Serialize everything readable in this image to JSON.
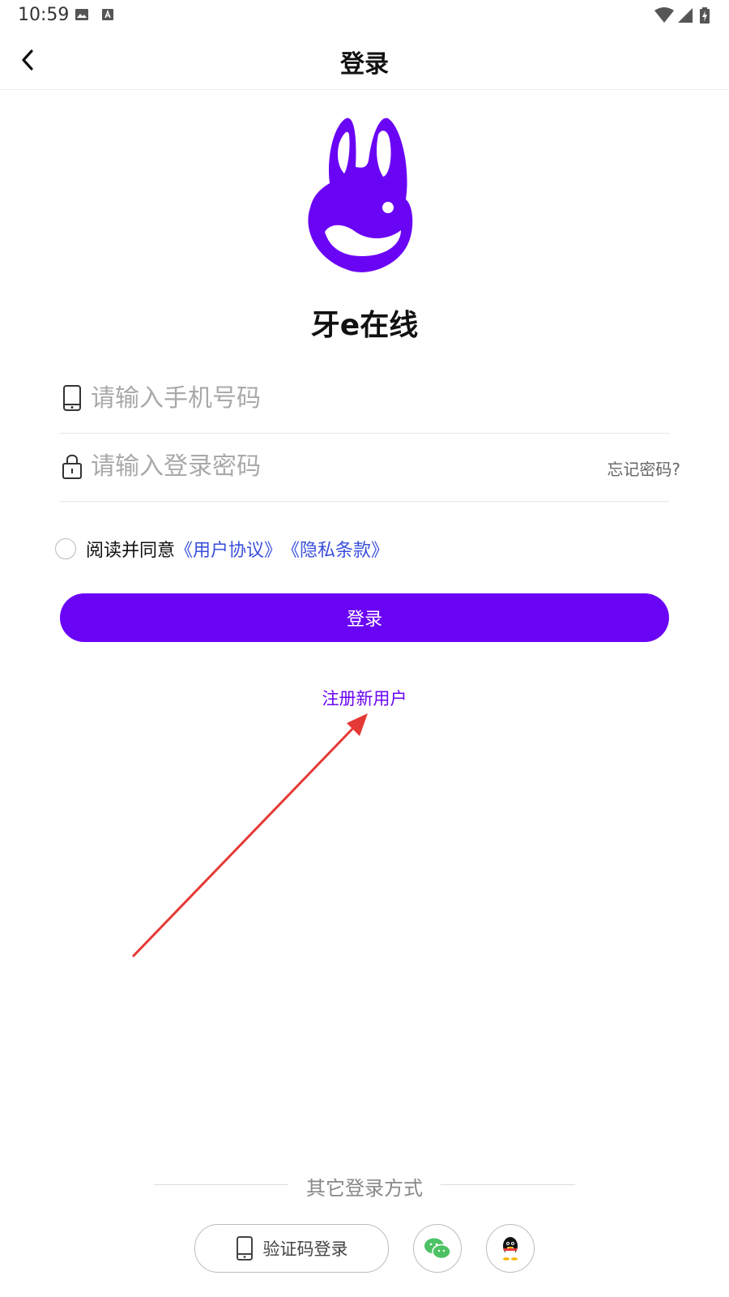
{
  "status_bar": {
    "time": "10:59"
  },
  "nav": {
    "title": "登录"
  },
  "app": {
    "name": "牙e在线",
    "brand_color": "#6a04f5"
  },
  "form": {
    "phone_placeholder": "请输入手机号码",
    "phone_value": "",
    "password_placeholder": "请输入登录密码",
    "password_value": "",
    "forgot_label": "忘记密码?"
  },
  "agreement": {
    "prefix": "阅读并同意",
    "user_agreement": "《用户协议》",
    "privacy": "《隐私条款》",
    "checked": false
  },
  "actions": {
    "login_label": "登录",
    "register_label": "注册新用户"
  },
  "other_login": {
    "title": "其它登录方式",
    "sms_label": "验证码登录",
    "icons": [
      "phone-icon",
      "wechat-icon",
      "qq-icon"
    ]
  },
  "colors": {
    "link_blue": "#3a4fdc",
    "annotation_arrow": "#e53935"
  }
}
